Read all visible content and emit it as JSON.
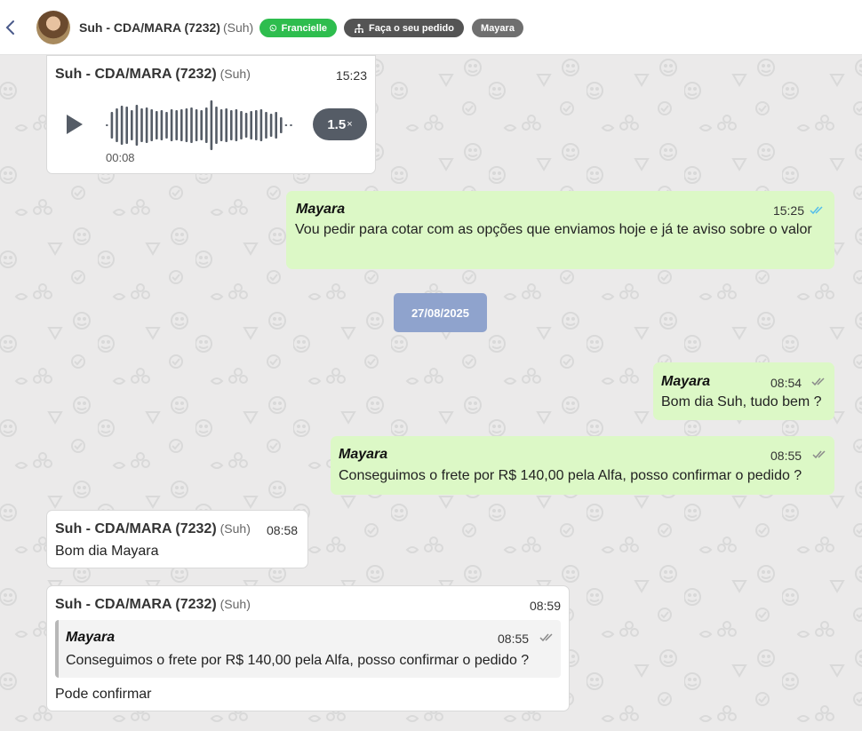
{
  "header": {
    "contact_name": "Suh - CDA/MARA (7232)",
    "contact_nick": "(Suh)",
    "tags": {
      "whatsapp_label": "Francielle",
      "order_label": "Faça o seu pedido",
      "user_label": "Mayara"
    },
    "colors": {
      "whatsapp": "#2ebd4e",
      "order": "#545454",
      "user": "#6f6f6f"
    }
  },
  "messages": {
    "audio": {
      "sender": "Suh - CDA/MARA (7232)",
      "nick": "(Suh)",
      "time": "15:23",
      "duration": "00:08",
      "speed": "1.5",
      "speed_suffix": "×"
    },
    "out1": {
      "sender": "Mayara",
      "time": "15:25",
      "text": "Vou pedir para cotar com as opções que enviamos hoje e já te aviso sobre o valor",
      "status": "read"
    },
    "date_separator": "27/08/2025",
    "out2": {
      "sender": "Mayara",
      "time": "08:54",
      "text": "Bom dia Suh, tudo bem ?",
      "status": "delivered"
    },
    "out3": {
      "sender": "Mayara",
      "time": "08:55",
      "text": "Conseguimos o frete por R$ 140,00 pela Alfa, posso confirmar o pedido ?",
      "status": "delivered"
    },
    "in1": {
      "sender": "Suh - CDA/MARA (7232)",
      "nick": "(Suh)",
      "time": "08:58",
      "text": "Bom dia Mayara"
    },
    "in2": {
      "sender": "Suh - CDA/MARA (7232)",
      "nick": "(Suh)",
      "time": "08:59",
      "quote": {
        "sender": "Mayara",
        "time": "08:55",
        "text": "Conseguimos o frete por R$ 140,00 pela Alfa, posso confirmar o pedido ?"
      },
      "text": "Pode confirmar"
    }
  },
  "colors": {
    "outgoing_bubble": "#dcf8c6",
    "incoming_bubble": "#ffffff",
    "date_chip": "#8fa3cd",
    "read_tick": "#53bdeb",
    "delivered_tick": "#8a8a8a"
  }
}
